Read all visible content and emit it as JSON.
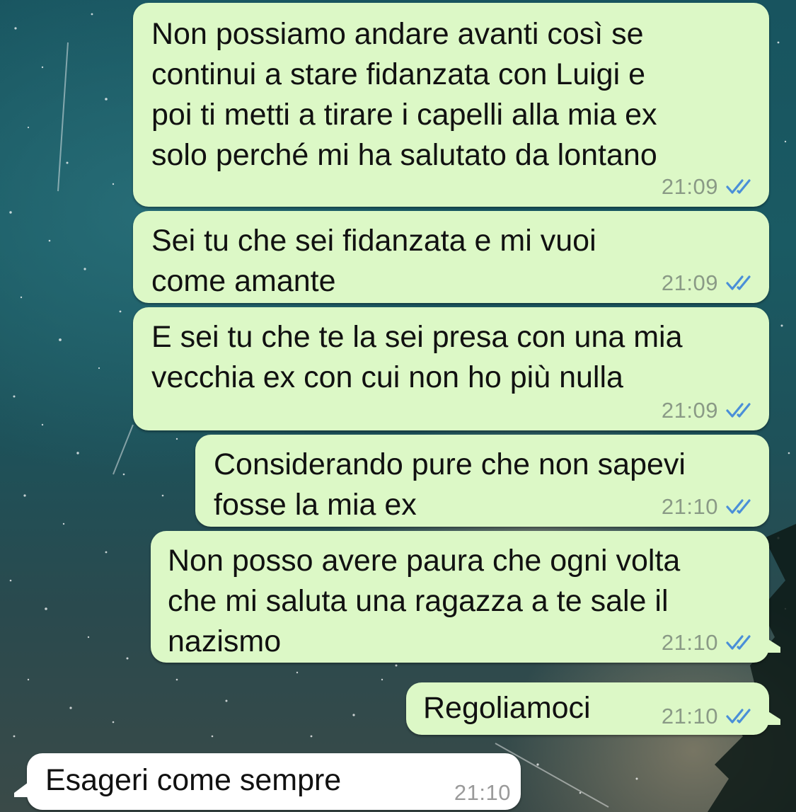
{
  "messages": [
    {
      "direction": "outgoing",
      "text": "Non possiamo andare avanti così se\ncontinui a stare fidanzata con Luigi e\npoi ti metti a tirare i capelli alla mia ex\nsolo perché mi ha salutato da lontano",
      "time": "21:09",
      "status_icon": "double-check-read-icon"
    },
    {
      "direction": "outgoing",
      "text": "Sei tu che sei fidanzata e mi vuoi\ncome amante",
      "time": "21:09",
      "status_icon": "double-check-read-icon"
    },
    {
      "direction": "outgoing",
      "text": "E sei tu che te la sei presa con una mia\nvecchia ex con cui non ho più nulla",
      "time": "21:09",
      "status_icon": "double-check-read-icon"
    },
    {
      "direction": "outgoing",
      "text": "Considerando pure che non sapevi\nfosse la mia ex",
      "time": "21:10",
      "status_icon": "double-check-read-icon"
    },
    {
      "direction": "outgoing",
      "text": "Non posso avere paura che ogni volta\nche mi saluta una ragazza a te sale il\nnazismo",
      "time": "21:10",
      "status_icon": "double-check-read-icon"
    },
    {
      "direction": "outgoing",
      "text": "Regoliamoci",
      "time": "21:10",
      "status_icon": "double-check-read-icon"
    },
    {
      "direction": "incoming",
      "text": "Esageri come sempre",
      "time": "21:10"
    }
  ],
  "colors": {
    "outgoing_bubble": "#dcf8c6",
    "incoming_bubble": "#ffffff",
    "read_ticks": "#4a8fd8",
    "timestamp": "#8a9a86"
  }
}
